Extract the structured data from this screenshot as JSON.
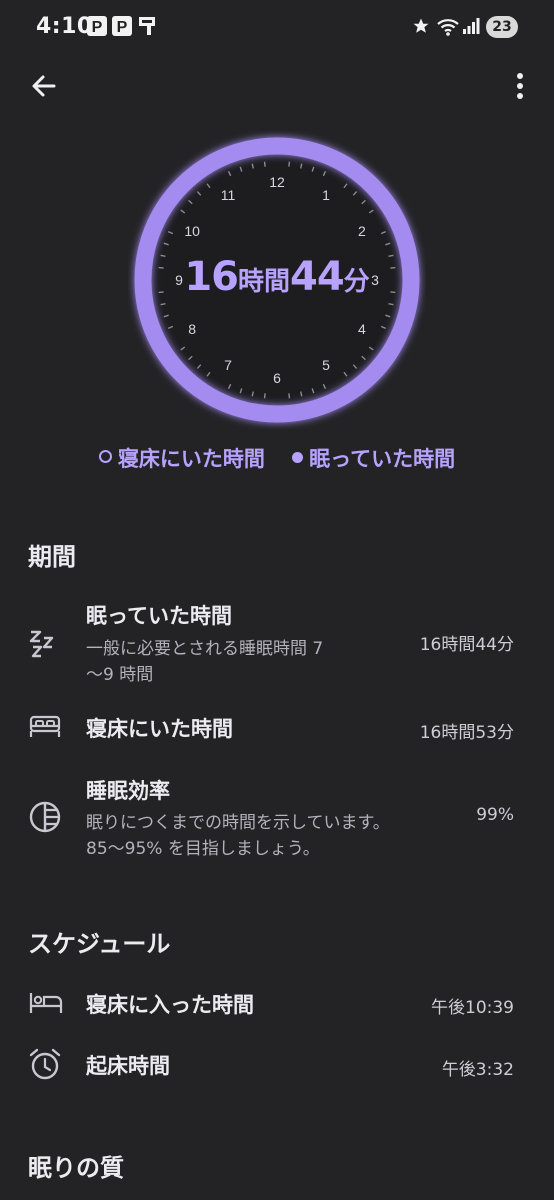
{
  "status_bar": {
    "time": "4:10",
    "notification_badge": "23",
    "icons": [
      "paypay-icon",
      "paypay-icon",
      "notification-icon",
      "star-icon",
      "wifi-icon",
      "signal-icon"
    ]
  },
  "toolbar": {
    "back_icon": "arrow-back-icon",
    "more_icon": "more-vert-icon"
  },
  "clock": {
    "numbers": [
      "12",
      "1",
      "2",
      "3",
      "4",
      "5",
      "6",
      "7",
      "8",
      "9",
      "10",
      "11"
    ],
    "duration_hours": "16",
    "hours_unit": "時間",
    "duration_minutes": "44",
    "minutes_unit": "分",
    "ring_color": "#a48bf0"
  },
  "legend": {
    "in_bed": "寝床にいた時間",
    "asleep": "眠っていた時間"
  },
  "period": {
    "heading": "期間",
    "rows": [
      {
        "icon": "zzz-icon",
        "title": "眠っていた時間",
        "subtitle_line1": "一般に必要とされる睡眠時間 7",
        "subtitle_line2": "〜9 時間",
        "value": "16時間44分"
      },
      {
        "icon": "bed-icon",
        "title": "寝床にいた時間",
        "value": "16時間53分"
      },
      {
        "icon": "efficiency-icon",
        "title": "睡眠効率",
        "subtitle_line1": "眠りにつくまでの時間を示しています。",
        "subtitle_line2": "85〜95% を目指しましょう。",
        "value": "99%"
      }
    ]
  },
  "schedule": {
    "heading": "スケジュール",
    "rows": [
      {
        "icon": "bed-time-icon",
        "title": "寝床に入った時間",
        "value": "午後10:39"
      },
      {
        "icon": "alarm-icon",
        "title": "起床時間",
        "value": "午後3:32"
      }
    ]
  },
  "quality": {
    "heading": "眠りの質"
  },
  "colors": {
    "accent": "#b7a3ff",
    "ring": "#a48bf0",
    "background": "#232326",
    "face": "#1d1d20"
  }
}
